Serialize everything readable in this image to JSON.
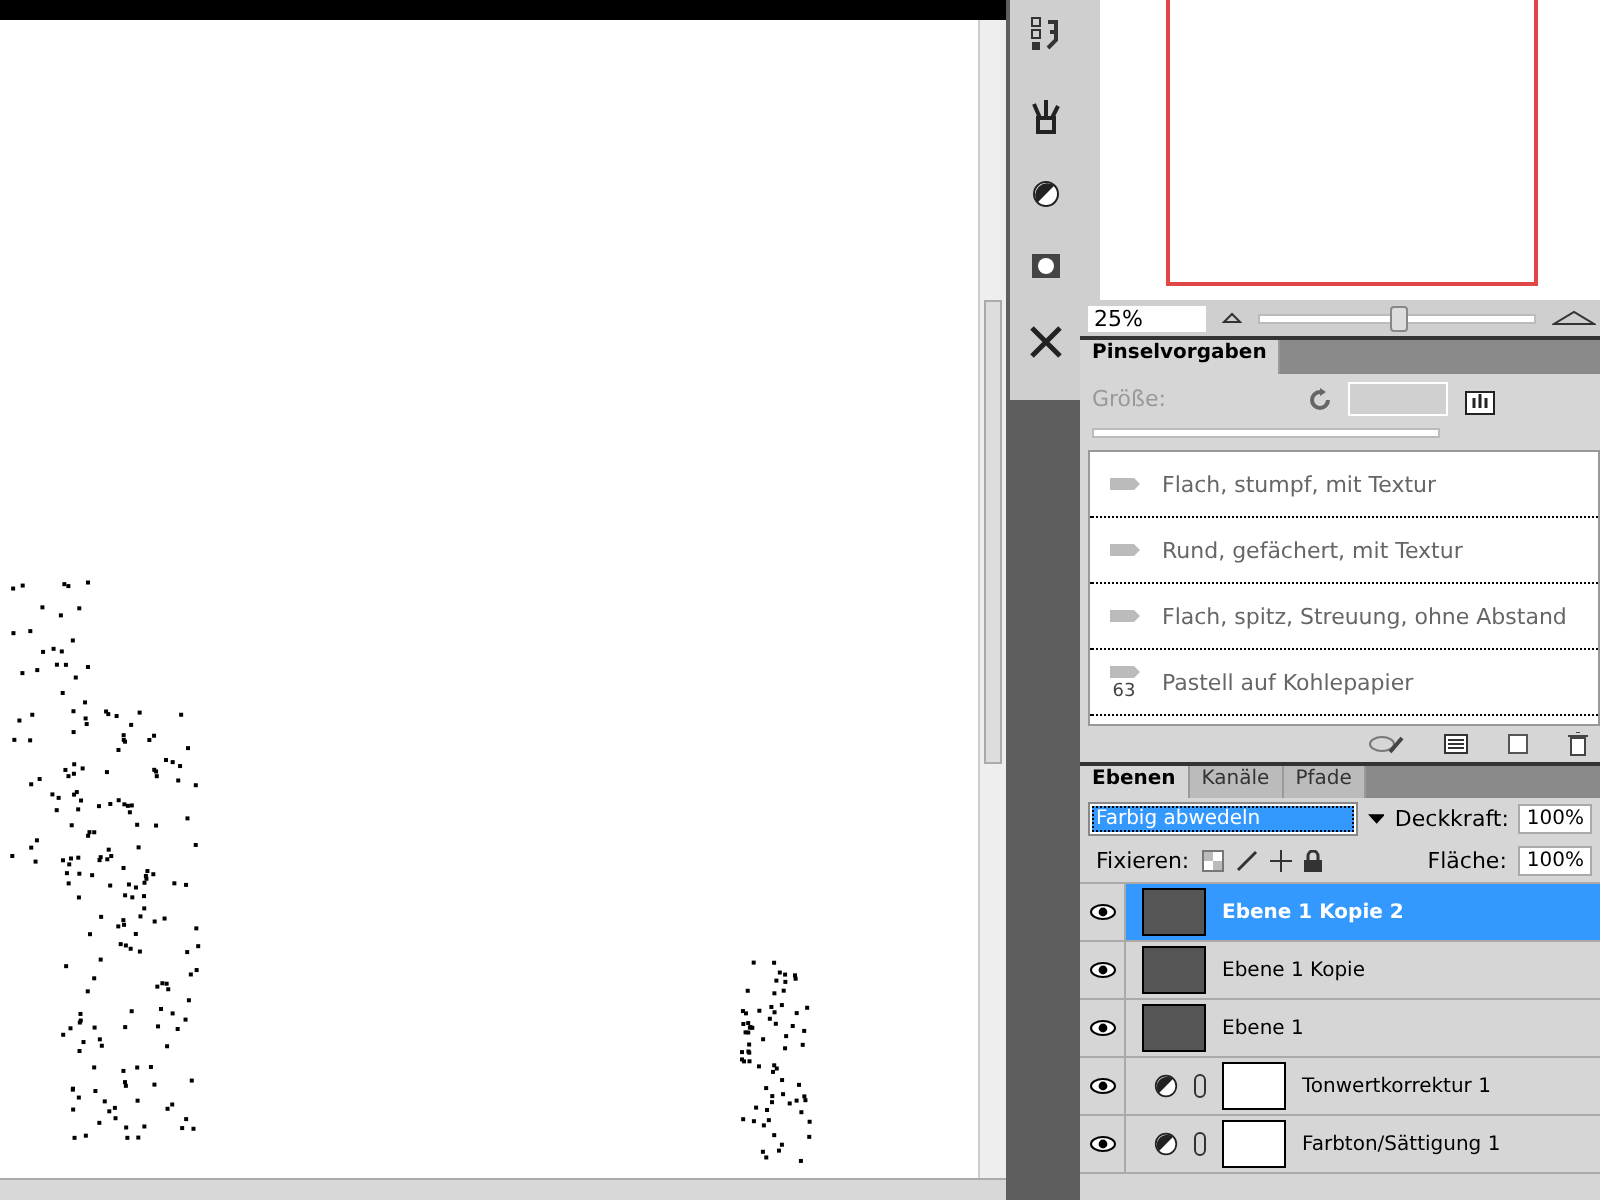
{
  "navigator": {
    "zoom": "25%",
    "level": 0.5
  },
  "brushes": {
    "tab": "Pinselvorgaben",
    "size_label": "Größe:",
    "presets": [
      {
        "name": "Flach, stumpf, mit Textur"
      },
      {
        "name": "Rund, gefächert, mit Textur"
      },
      {
        "name": "Flach, spitz, Streuung, ohne Abstand"
      },
      {
        "name": "Pastell auf Kohlepapier",
        "size": "63"
      }
    ]
  },
  "layers_panel": {
    "tabs": [
      {
        "label": "Ebenen",
        "selected": true
      },
      {
        "label": "Kanäle",
        "selected": false
      },
      {
        "label": "Pfade",
        "selected": false
      }
    ],
    "blend_mode": "Farbig abwedeln",
    "opacity_label": "Deckkraft:",
    "opacity": "100%",
    "lock_label": "Fixieren:",
    "fill_label": "Fläche:",
    "fill": "100%",
    "layers": [
      {
        "name": "Ebene 1 Kopie 2",
        "kind": "image",
        "selected": true,
        "visible": true
      },
      {
        "name": "Ebene 1 Kopie",
        "kind": "image",
        "selected": false,
        "visible": true
      },
      {
        "name": "Ebene 1",
        "kind": "image",
        "selected": false,
        "visible": true
      },
      {
        "name": "Tonwertkorrektur 1",
        "kind": "adjustment",
        "selected": false,
        "visible": true
      },
      {
        "name": "Farbton/Sättigung 1",
        "kind": "adjustment",
        "selected": false,
        "visible": true
      }
    ]
  }
}
